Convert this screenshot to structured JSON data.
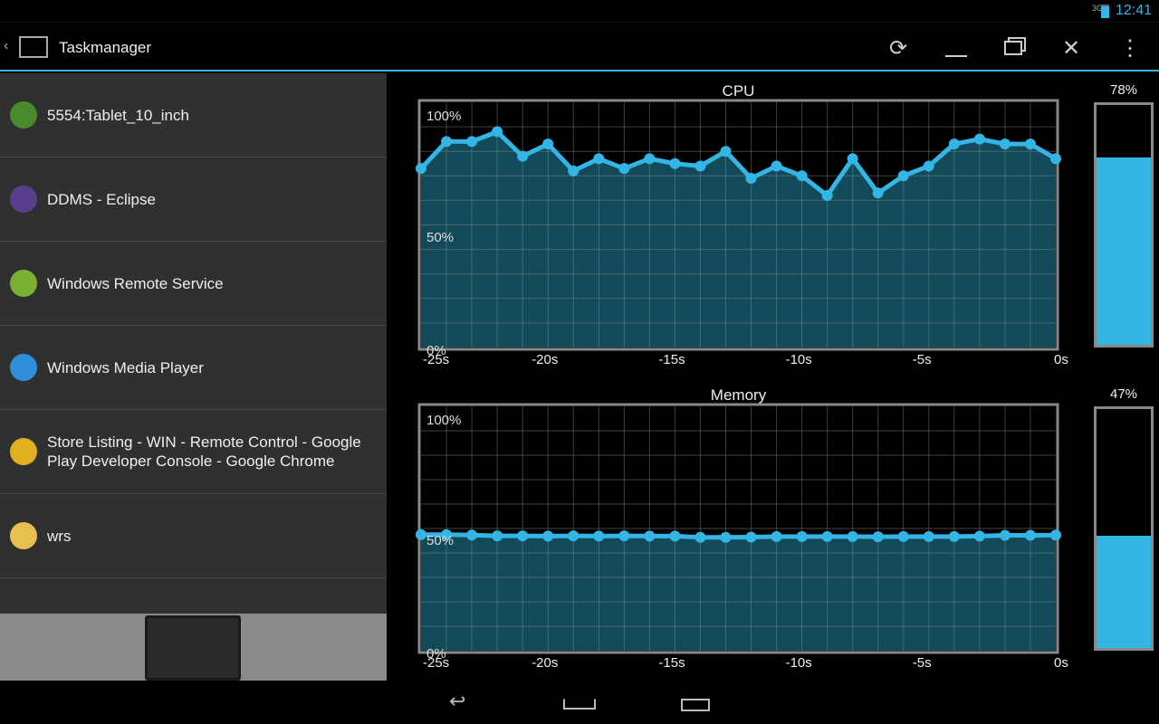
{
  "status_bar": {
    "network": "3G",
    "time": "12:41"
  },
  "action_bar": {
    "title": "Taskmanager",
    "buttons": [
      "refresh",
      "minimize",
      "restore",
      "close",
      "overflow"
    ]
  },
  "windows": [
    {
      "label": "5554:Tablet_10_inch",
      "icon": "android-emulator-icon",
      "color": "#4a8a2a"
    },
    {
      "label": "DDMS - Eclipse",
      "icon": "eclipse-icon",
      "color": "#5b3f8f"
    },
    {
      "label": "Windows Remote Service",
      "icon": "windows-remote-icon",
      "color": "#7ab030"
    },
    {
      "label": "Windows Media Player",
      "icon": "media-player-icon",
      "color": "#2e8fd8"
    },
    {
      "label": "Store Listing - WIN - Remote Control - Google Play Developer Console - Google Chrome",
      "icon": "chrome-icon",
      "color": "#e0b020"
    },
    {
      "label": "wrs",
      "icon": "folder-icon",
      "color": "#e8c050"
    }
  ],
  "colors": {
    "accent": "#33b5e5",
    "area": "#134a5a"
  },
  "chart_data": [
    {
      "type": "area",
      "title": "CPU",
      "x": [
        -25,
        -24,
        -23,
        -22,
        -21,
        -20,
        -19,
        -18,
        -17,
        -16,
        -15,
        -14,
        -13,
        -12,
        -11,
        -10,
        -9,
        -8,
        -7,
        -6,
        -5,
        -4,
        -3,
        -2,
        -1,
        0
      ],
      "values": [
        73,
        84,
        84,
        88,
        78,
        83,
        72,
        77,
        73,
        77,
        75,
        74,
        80,
        69,
        74,
        70,
        62,
        77,
        63,
        70,
        74,
        83,
        85,
        83,
        83,
        77
      ],
      "xtick_labels": [
        "-25s",
        "-20s",
        "-15s",
        "-10s",
        "-5s",
        "0s"
      ],
      "ytick_labels": [
        "100%",
        "50%",
        "0%"
      ],
      "ylim": [
        0,
        100
      ],
      "grid": true,
      "current": "78%",
      "current_value": 78
    },
    {
      "type": "area",
      "title": "Memory",
      "x": [
        -25,
        -24,
        -23,
        -22,
        -21,
        -20,
        -19,
        -18,
        -17,
        -16,
        -15,
        -14,
        -13,
        -12,
        -11,
        -10,
        -9,
        -8,
        -7,
        -6,
        -5,
        -4,
        -3,
        -2,
        -1,
        0
      ],
      "values": [
        47.5,
        47.5,
        47.3,
        47,
        47,
        46.9,
        47,
        46.9,
        47,
        46.9,
        46.9,
        46.4,
        46.4,
        46.5,
        46.7,
        46.7,
        46.7,
        46.7,
        46.6,
        46.7,
        46.7,
        46.7,
        46.9,
        47.2,
        47.2,
        47.3
      ],
      "xtick_labels": [
        "-25s",
        "-20s",
        "-15s",
        "-10s",
        "-5s",
        "0s"
      ],
      "ytick_labels": [
        "100%",
        "50%",
        "0%"
      ],
      "ylim": [
        0,
        100
      ],
      "grid": true,
      "current": "47%",
      "current_value": 47
    }
  ]
}
